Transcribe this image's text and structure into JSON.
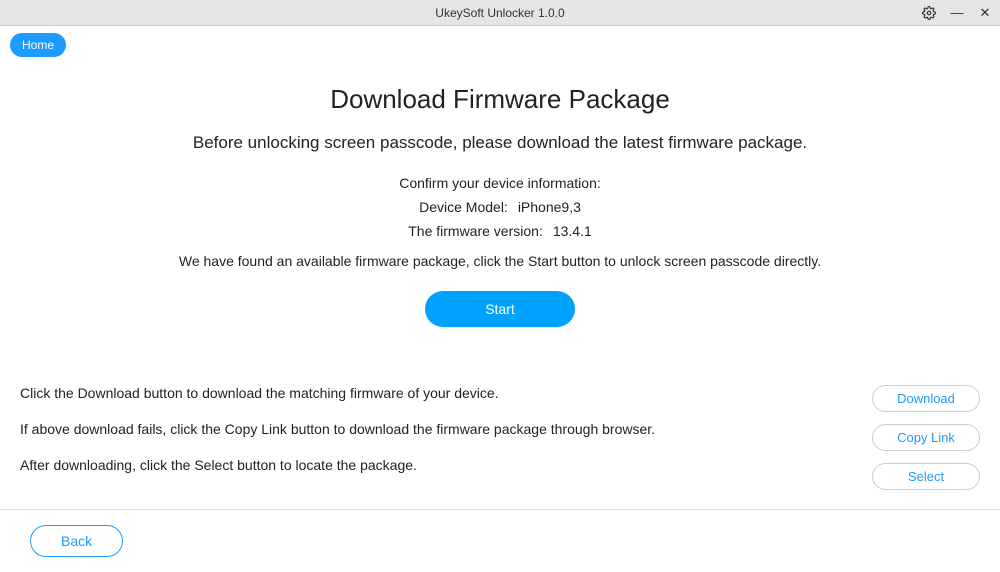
{
  "titlebar": {
    "title": "UkeySoft Unlocker 1.0.0"
  },
  "nav": {
    "home": "Home"
  },
  "main": {
    "title": "Download Firmware Package",
    "subtitle": "Before unlocking screen passcode, please download the latest firmware package.",
    "confirm_label": "Confirm your device information:",
    "device_model_label": "Device Model:",
    "device_model_value": "iPhone9,3",
    "firmware_label": "The firmware version:",
    "firmware_value": "13.4.1",
    "found_text": "We have found an available firmware package, click the Start button to unlock screen passcode directly.",
    "start_label": "Start"
  },
  "instructions": {
    "line1": "Click the Download button to download the matching firmware of your device.",
    "line2": "If above download fails, click the Copy Link button to download the firmware package through browser.",
    "line3": "After downloading, click the Select button to locate the package."
  },
  "actions": {
    "download": "Download",
    "copy_link": "Copy Link",
    "select": "Select"
  },
  "footer": {
    "back": "Back"
  }
}
